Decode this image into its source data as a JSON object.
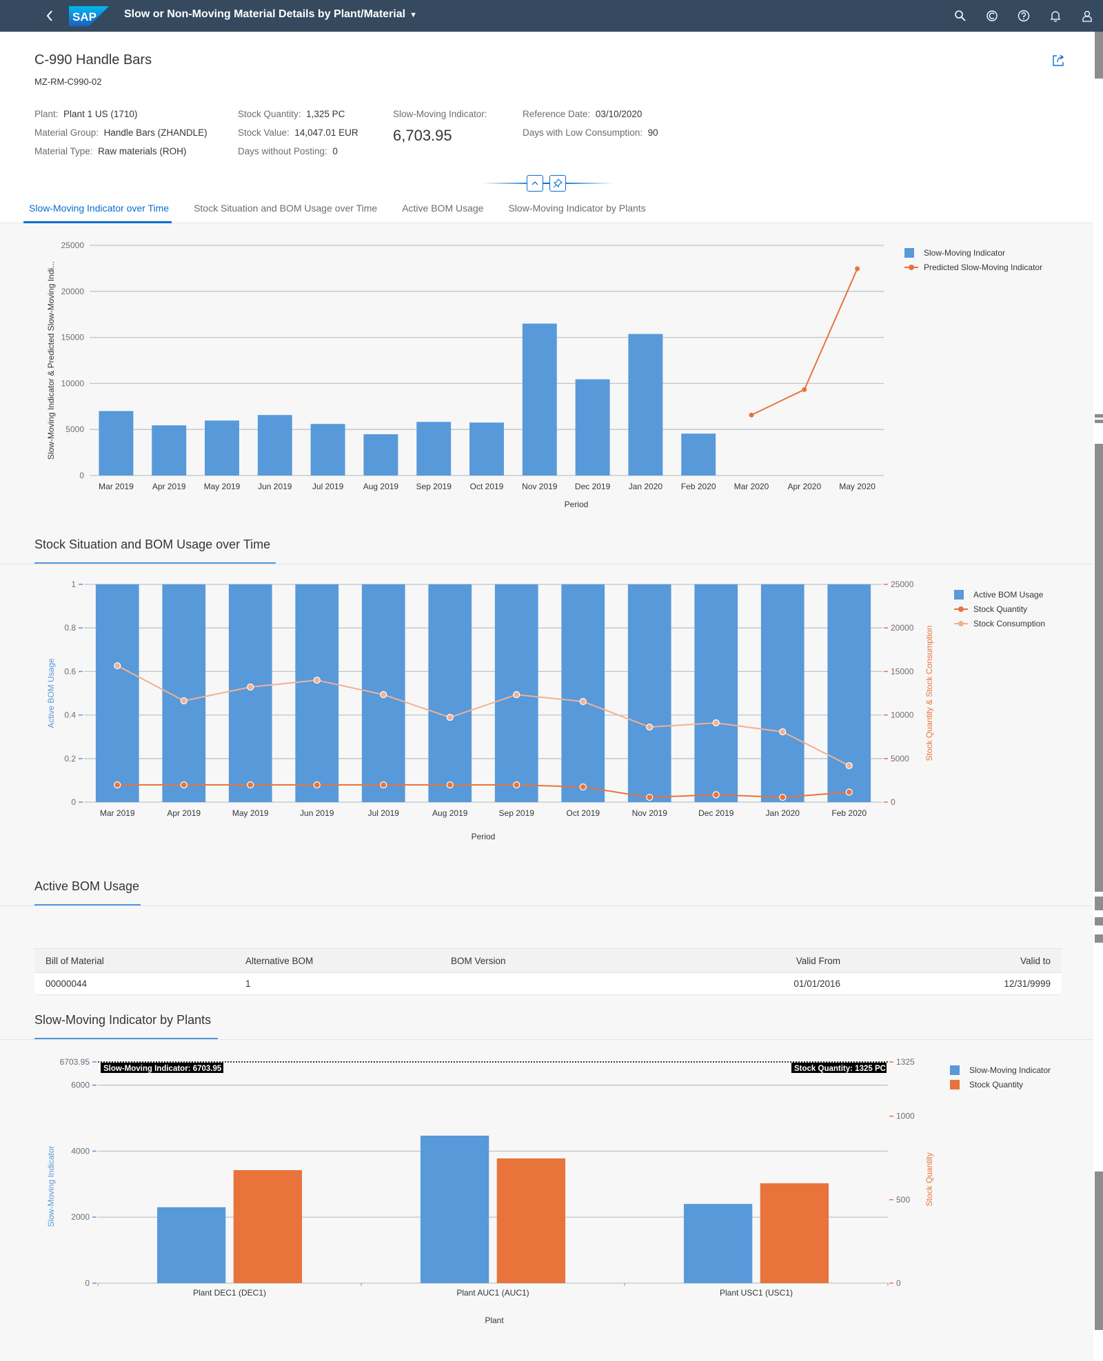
{
  "shell": {
    "app_title": "Slow or Non-Moving Material Details by Plant/Material",
    "logo_text": "SAP",
    "actions": [
      "search-icon",
      "copilot-icon",
      "help-icon",
      "notifications-icon",
      "user-icon"
    ]
  },
  "header": {
    "title": "C-990 Handle Bars",
    "subtitle": "MZ-RM-C990-02",
    "facets": {
      "col1": [
        {
          "label": "Plant:",
          "value": "Plant 1 US (1710)"
        },
        {
          "label": "Material Group:",
          "value": "Handle Bars (ZHANDLE)"
        },
        {
          "label": "Material Type:",
          "value": "Raw materials (ROH)"
        }
      ],
      "col2": [
        {
          "label": "Stock Quantity:",
          "value": "1,325 PC"
        },
        {
          "label": "Stock Value:",
          "value": "14,047.01  EUR"
        },
        {
          "label": "Days without Posting:",
          "value": "0"
        }
      ],
      "kpi": {
        "label": "Slow-Moving Indicator:",
        "value": "6,703.95"
      },
      "col4": [
        {
          "label": "Reference Date:",
          "value": "03/10/2020"
        },
        {
          "label": "Days with Low Consumption:",
          "value": "90"
        }
      ]
    }
  },
  "tabs": [
    {
      "label": "Slow-Moving Indicator over Time",
      "active": true
    },
    {
      "label": "Stock Situation and BOM Usage over Time",
      "active": false
    },
    {
      "label": "Active BOM Usage",
      "active": false
    },
    {
      "label": "Slow-Moving Indicator by Plants",
      "active": false
    }
  ],
  "sections": {
    "stock_title": "Stock Situation and BOM Usage over Time",
    "bom_title": "Active BOM Usage",
    "plants_title": "Slow-Moving Indicator by Plants"
  },
  "colors": {
    "blue": "#5899da",
    "orange": "#e8743b",
    "light_orange": "#f2b191",
    "shell": "#354a5f",
    "accent": "#0a6ed1"
  },
  "bom_table": {
    "columns": [
      "Bill of Material",
      "Alternative BOM",
      "BOM Version",
      "Valid From",
      "Valid to"
    ],
    "rows": [
      [
        "00000044",
        "1",
        "",
        "01/01/2016",
        "12/31/9999"
      ]
    ]
  },
  "chart_data": [
    {
      "id": "smi_over_time",
      "type": "bar",
      "title": "",
      "xlabel": "Period",
      "ylabel": "Slow-Moving Indicator & Predicted Slow-Moving Indi...",
      "ylim": [
        0,
        25000
      ],
      "yticks": [
        0,
        5000,
        10000,
        15000,
        20000,
        25000
      ],
      "grid": true,
      "legend": "top-right",
      "categories": [
        "Mar 2019",
        "Apr 2019",
        "May 2019",
        "Jun 2019",
        "Jul 2019",
        "Aug 2019",
        "Sep 2019",
        "Oct 2019",
        "Nov 2019",
        "Dec 2019",
        "Jan 2020",
        "Feb 2020",
        "Mar 2020",
        "Apr 2020",
        "May 2020"
      ],
      "series": [
        {
          "name": "Slow-Moving Indicator",
          "kind": "bar",
          "values": [
            7000,
            5450,
            5970,
            6570,
            5600,
            4480,
            5820,
            5750,
            16500,
            10450,
            15370,
            4550,
            null,
            null,
            null
          ]
        },
        {
          "name": "Predicted Slow-Moving Indicator",
          "kind": "line",
          "values": [
            null,
            null,
            null,
            null,
            null,
            null,
            null,
            null,
            null,
            null,
            null,
            null,
            6570,
            9330,
            22460
          ]
        }
      ]
    },
    {
      "id": "stock_bom_over_time",
      "type": "bar",
      "title": "Stock Situation and BOM Usage over Time",
      "xlabel": "Period",
      "ylabel": "Active BOM Usage",
      "y2label": "Stock Quantity & Stock Consumption",
      "ylim": [
        0,
        1
      ],
      "yticks": [
        0,
        0.2,
        0.4,
        0.6,
        0.8,
        1
      ],
      "y2lim": [
        0,
        25000
      ],
      "y2ticks": [
        0,
        5000,
        10000,
        15000,
        20000,
        25000
      ],
      "grid": true,
      "legend": "top-right",
      "categories": [
        "Mar 2019",
        "Apr 2019",
        "May 2019",
        "Jun 2019",
        "Jul 2019",
        "Aug 2019",
        "Sep 2019",
        "Oct 2019",
        "Nov 2019",
        "Dec 2019",
        "Jan 2020",
        "Feb 2020"
      ],
      "series": [
        {
          "name": "Active BOM Usage",
          "kind": "bar",
          "axis": "left",
          "values": [
            1,
            1,
            1,
            1,
            1,
            1,
            1,
            1,
            1,
            1,
            1,
            1
          ]
        },
        {
          "name": "Stock Quantity",
          "kind": "line",
          "axis": "right",
          "values": [
            1980,
            1980,
            1980,
            1980,
            1980,
            1980,
            1980,
            1740,
            550,
            850,
            550,
            1150
          ]
        },
        {
          "name": "Stock Consumption",
          "kind": "line",
          "axis": "right",
          "values": [
            15660,
            11630,
            13210,
            14000,
            12340,
            9730,
            12340,
            11550,
            8620,
            9100,
            8070,
            4190
          ]
        }
      ]
    },
    {
      "id": "smi_by_plants",
      "type": "bar",
      "title": "Slow-Moving Indicator by Plants",
      "xlabel": "Plant",
      "ylabel": "Slow-Moving Indicator",
      "y2label": "Stock Quantity",
      "ylim": [
        0,
        6703.95
      ],
      "yticks": [
        0,
        2000,
        4000,
        6000,
        6703.95
      ],
      "y2lim": [
        0,
        1325
      ],
      "y2ticks": [
        0,
        500,
        1000,
        1325
      ],
      "grid": true,
      "legend": "top-right",
      "categories": [
        "Plant DEC1 (DEC1)",
        "Plant AUC1 (AUC1)",
        "Plant USC1 (USC1)"
      ],
      "series": [
        {
          "name": "Slow-Moving Indicator",
          "axis": "left",
          "values": [
            2300,
            4470,
            2400
          ]
        },
        {
          "name": "Stock Quantity",
          "axis": "right",
          "values": [
            677,
            747,
            598
          ]
        }
      ],
      "reference_lines": [
        {
          "label": "Slow-Moving Indicator: 6703.95",
          "axis": "left",
          "value": 6703.95
        },
        {
          "label": "Stock Quantity: 1325 PC",
          "axis": "right",
          "value": 1325
        }
      ]
    }
  ]
}
